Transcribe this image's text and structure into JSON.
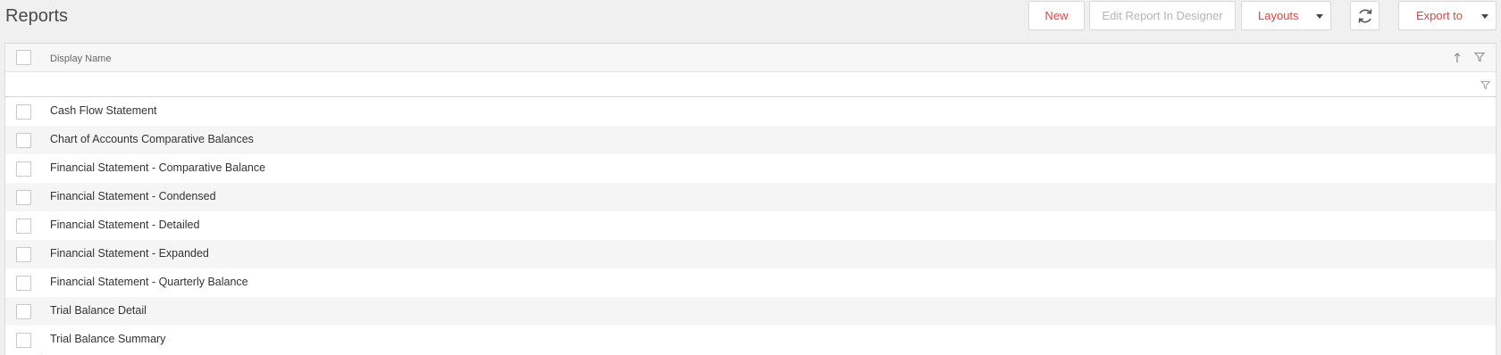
{
  "header": {
    "title": "Reports"
  },
  "toolbar": {
    "new_label": "New",
    "edit_label": "Edit Report In Designer",
    "layouts_label": "Layouts",
    "export_label": "Export to",
    "refresh_icon": "refresh-icon",
    "accent_color": "#e8403e"
  },
  "grid": {
    "column_header": "Display Name",
    "rows": [
      "Cash Flow Statement",
      "Chart of Accounts Comparative Balances",
      "Financial Statement - Comparative Balance",
      "Financial Statement - Condensed",
      "Financial Statement - Detailed",
      "Financial Statement - Expanded",
      "Financial Statement - Quarterly Balance",
      "Trial Balance Detail",
      "Trial Balance Summary"
    ]
  }
}
